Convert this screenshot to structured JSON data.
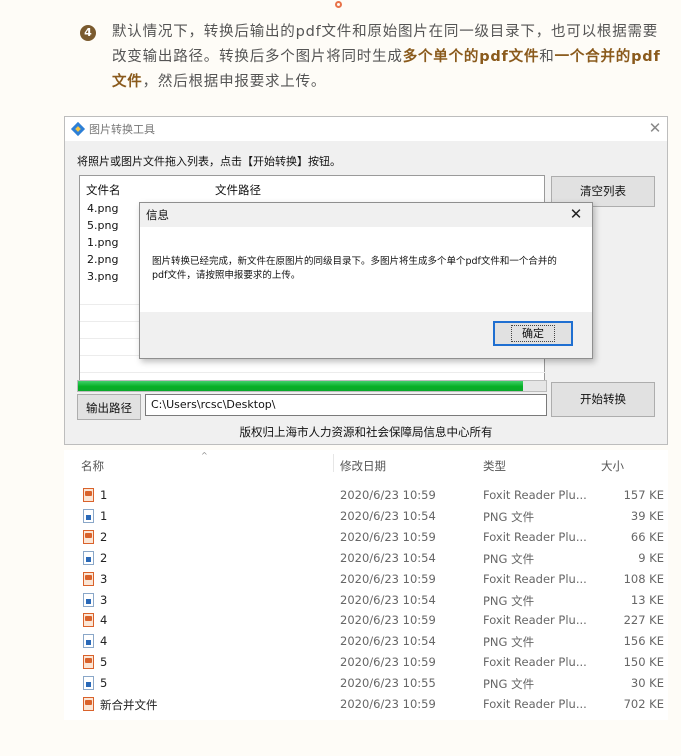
{
  "article": {
    "step_number": "4",
    "text_part1": "默认情况下，转换后输出的pdf文件和原始图片在同一级目录下，也可以根据需要改变输出路径。转换后多个图片将同时生成",
    "text_bold1": "多个单个的pdf文件",
    "text_part2": "和",
    "text_bold2": "一个合并的pdf文件",
    "text_part3": "，然后根据申报要求上传。"
  },
  "window": {
    "title": "图片转换工具",
    "close": "✕",
    "instruction": "将照片或图片文件拖入列表，点击【开始转换】按钮。",
    "col_name": "文件名",
    "col_path": "文件路径",
    "files": [
      "4.png",
      "5.png",
      "1.png",
      "2.png",
      "3.png"
    ],
    "clear_button": "清空列表",
    "start_button": "开始转换",
    "progress_percent": 95,
    "output_button": "输出路径",
    "output_path": "C:\\Users\\rcsc\\Desktop\\",
    "copyright": "版权归上海市人力资源和社会保障局信息中心所有"
  },
  "message": {
    "title": "信息",
    "close": "✕",
    "text": "图片转换已经完成，新文件在原图片的同级目录下。多图片将生成多个单个pdf文件和一个合并的pdf文件，请按照申报要求的上传。",
    "ok": "确定"
  },
  "explorer": {
    "headers": {
      "name": "名称",
      "date": "修改日期",
      "type": "类型",
      "size": "大小"
    },
    "sort_glyph": "^",
    "rows": [
      {
        "icon": "pdf",
        "name": "1",
        "date": "2020/6/23 10:59",
        "type": "Foxit Reader Plu...",
        "size": "157 KE"
      },
      {
        "icon": "png",
        "name": "1",
        "date": "2020/6/23 10:54",
        "type": "PNG 文件",
        "size": "39 KE"
      },
      {
        "icon": "pdf",
        "name": "2",
        "date": "2020/6/23 10:59",
        "type": "Foxit Reader Plu...",
        "size": "66 KE"
      },
      {
        "icon": "png",
        "name": "2",
        "date": "2020/6/23 10:54",
        "type": "PNG 文件",
        "size": "9 KE"
      },
      {
        "icon": "pdf",
        "name": "3",
        "date": "2020/6/23 10:59",
        "type": "Foxit Reader Plu...",
        "size": "108 KE"
      },
      {
        "icon": "png",
        "name": "3",
        "date": "2020/6/23 10:54",
        "type": "PNG 文件",
        "size": "13 KE"
      },
      {
        "icon": "pdf",
        "name": "4",
        "date": "2020/6/23 10:59",
        "type": "Foxit Reader Plu...",
        "size": "227 KE"
      },
      {
        "icon": "png",
        "name": "4",
        "date": "2020/6/23 10:54",
        "type": "PNG 文件",
        "size": "156 KE"
      },
      {
        "icon": "pdf",
        "name": "5",
        "date": "2020/6/23 10:59",
        "type": "Foxit Reader Plu...",
        "size": "150 KE"
      },
      {
        "icon": "png",
        "name": "5",
        "date": "2020/6/23 10:55",
        "type": "PNG 文件",
        "size": "30 KE"
      },
      {
        "icon": "pdf",
        "name": "新合并文件",
        "date": "2020/6/23 10:59",
        "type": "Foxit Reader Plu...",
        "size": "702 KE"
      }
    ]
  }
}
